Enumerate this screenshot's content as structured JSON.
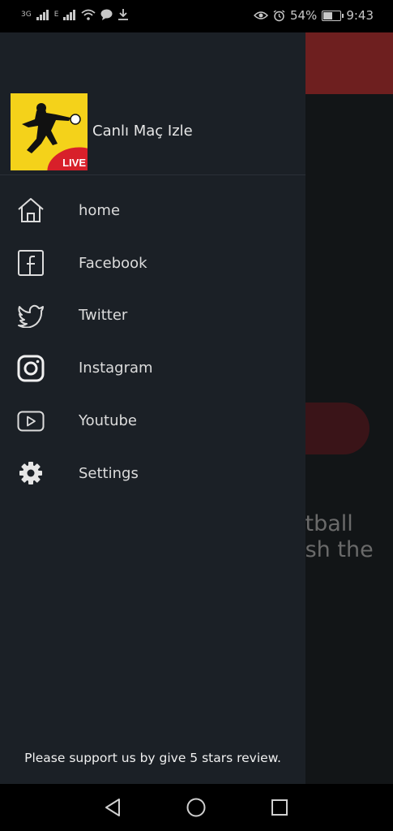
{
  "status_bar": {
    "net1": "3G",
    "net2": "E",
    "battery_percent": "54%",
    "battery_level": 0.54,
    "time": "9:43"
  },
  "background": {
    "text_line1": "otball",
    "text_line2": "esh the"
  },
  "drawer": {
    "app_name": "Canlı Maç Izle",
    "logo_badge": "LIVE",
    "items": [
      {
        "label": "home",
        "icon": "home-icon"
      },
      {
        "label": "Facebook",
        "icon": "facebook-icon"
      },
      {
        "label": "Twitter",
        "icon": "twitter-icon"
      },
      {
        "label": "Instagram",
        "icon": "instagram-icon"
      },
      {
        "label": "Youtube",
        "icon": "youtube-icon"
      },
      {
        "label": "Settings",
        "icon": "gear-icon"
      }
    ],
    "support_text": "Please support us by give 5 stars review."
  },
  "colors": {
    "drawer_bg": "#1b2026",
    "appbar_red": "#6e1f1f",
    "logo_yellow": "#f4d21a"
  }
}
